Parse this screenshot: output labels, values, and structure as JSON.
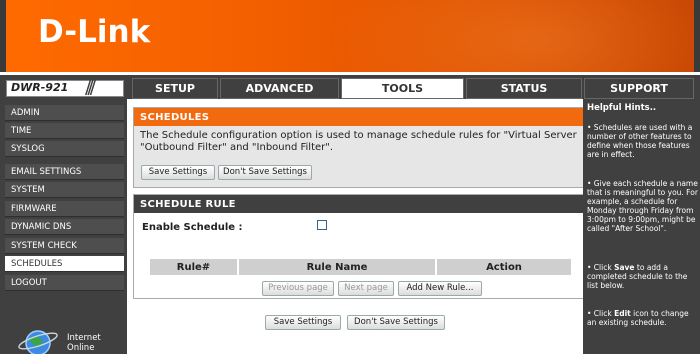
{
  "brand": {
    "logo": "D-Link",
    "model": "DWR-921"
  },
  "nav": {
    "tabs": [
      {
        "label": "SETUP"
      },
      {
        "label": "ADVANCED"
      },
      {
        "label": "TOOLS"
      },
      {
        "label": "STATUS"
      },
      {
        "label": "SUPPORT"
      }
    ],
    "active": "TOOLS"
  },
  "sidebar": {
    "items": [
      {
        "label": "ADMIN"
      },
      {
        "label": "TIME"
      },
      {
        "label": "SYSLOG"
      },
      {
        "label": "EMAIL SETTINGS"
      },
      {
        "label": "SYSTEM"
      },
      {
        "label": "FIRMWARE"
      },
      {
        "label": "DYNAMIC DNS"
      },
      {
        "label": "SYSTEM CHECK"
      },
      {
        "label": "SCHEDULES"
      },
      {
        "label": "LOGOUT"
      }
    ],
    "active": "SCHEDULES",
    "status": {
      "line1": "Internet",
      "line2": "Online"
    }
  },
  "schedules": {
    "title": "SCHEDULES",
    "description": "The Schedule configuration option is used to manage schedule rules for \"Virtual Server \"Outbound Filter\" and \"Inbound Filter\".",
    "save_label": "Save Settings",
    "dont_save_label": "Don't Save Settings"
  },
  "schedule_rule": {
    "title": "SCHEDULE RULE",
    "enable_label": "Enable Schedule :",
    "enable_checked": false,
    "columns": [
      "Rule#",
      "Rule Name",
      "Action"
    ],
    "previous_label": "Previous page",
    "next_label": "Next page",
    "add_label": "Add New Rule..."
  },
  "footer": {
    "save_label": "Save Settings",
    "dont_save_label": "Don't Save Settings"
  },
  "hints": {
    "title": "Helpful Hints..",
    "h1": "• Schedules are used with a number of other features to define when those features are in effect.",
    "h2": "• Give each schedule a name that is meaningful to you. For example, a schedule for Monday through Friday from 3:00pm to 9:00pm, might be called \"After School\".",
    "h3_pre": "• Click ",
    "h3_bold": "Save",
    "h3_post": " to add a completed schedule to the list below.",
    "h4_pre": "• Click ",
    "h4_bold": "Edit",
    "h4_post": " icon to change an existing schedule."
  },
  "colors": {
    "accent": "#f26a10",
    "dark": "#404040",
    "panel": "#e6e6e6"
  }
}
